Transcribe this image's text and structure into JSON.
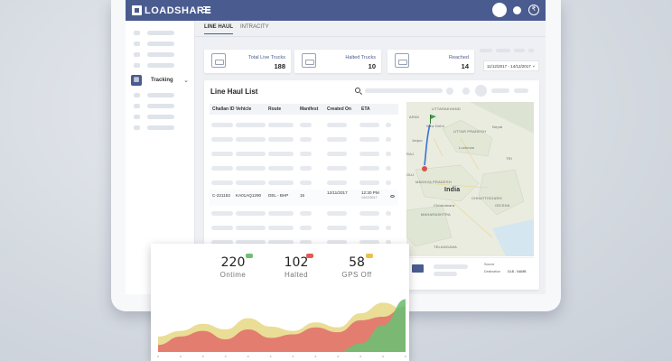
{
  "brand": {
    "logo_text": "LOADSHARE"
  },
  "topbar": {
    "rupee_icon": "₹"
  },
  "sidebar": {
    "active_item": {
      "label": "Tracking",
      "icon": "tracking-icon"
    }
  },
  "tabs": [
    {
      "label": "LINE HAUL"
    },
    {
      "label": "INTRACITY"
    }
  ],
  "stats": [
    {
      "label": "Total Live Trucks",
      "value": "188"
    },
    {
      "label": "Halted Trucks",
      "value": "10"
    },
    {
      "label": "Reached",
      "value": "14"
    }
  ],
  "date_range": {
    "value": "11/12/2017 - 14/12/2017"
  },
  "list": {
    "title": "Line Haul List",
    "columns": [
      "Challan ID",
      "Vehicle",
      "Route",
      "Manifest",
      "Created On",
      "ETA"
    ],
    "row": {
      "challan_id": "C-221153",
      "vehicle": "KA01AQ1290",
      "route": "DEL - BHP",
      "manifest": "15",
      "created_on": "12/11/2017",
      "eta_time": "12:30 PM",
      "eta_date": "14/12/2017"
    }
  },
  "map": {
    "labels": {
      "uttarakhand": "UTTARAKHAND",
      "nepal": "Nepal",
      "new_delhi": "New Delhi",
      "jaipur": "Jaipur",
      "uttar_pradesh": "UTTAR PRADESH",
      "lucknow": "Lucknow",
      "madhya_pradesh": "MADHYA PRADESH",
      "india": "India",
      "chhattisgarh": "CHHATTISGARH",
      "maharashtra": "MAHARASHTRA",
      "telangana": "TELANGANA",
      "odisha": "ODISHA",
      "chhindwara": "Chhindwara",
      "arav": "ARAV",
      "gujarat": "GUJ",
      "tri": "TRI",
      "rajasthan": "RAJ"
    }
  },
  "truck_card": {
    "origin_label": "Source",
    "destination_label": "Destination",
    "destination_value": "DLB - NAMB"
  },
  "kpis": [
    {
      "value": "220",
      "label": "Ontime",
      "color": "#6fbf73"
    },
    {
      "value": "102",
      "label": "Halted",
      "color": "#e15a54"
    },
    {
      "value": "58",
      "label": "GPS Off",
      "color": "#e8c24a"
    }
  ],
  "chart_data": {
    "type": "area",
    "x": [
      1,
      2,
      3,
      4,
      5,
      6,
      7,
      8,
      9,
      10,
      11,
      12
    ],
    "series": [
      {
        "values": [
          22,
          30,
          40,
          32,
          48,
          36,
          30,
          42,
          35,
          55,
          70,
          60
        ],
        "color": "#e8d98a"
      },
      {
        "values": [
          10,
          22,
          30,
          18,
          32,
          20,
          25,
          35,
          28,
          45,
          50,
          65
        ],
        "color": "#e2726b"
      },
      {
        "values": [
          0,
          0,
          0,
          0,
          0,
          0,
          0,
          0,
          0,
          12,
          38,
          75
        ],
        "color": "#6fbf73"
      }
    ],
    "ylim": [
      0,
      100
    ],
    "grid": false,
    "legend": "none"
  }
}
